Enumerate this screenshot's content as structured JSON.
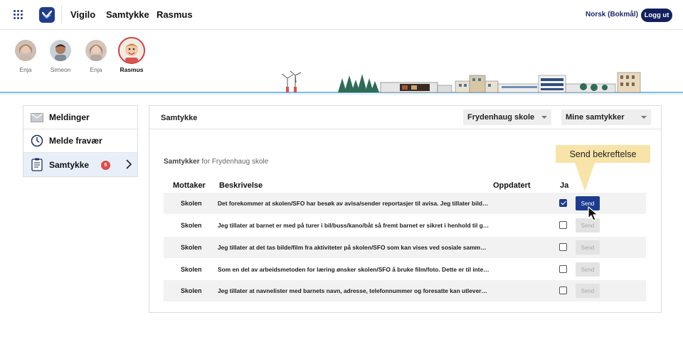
{
  "topbar": {
    "brand": "Vigilo",
    "nav": [
      "Samtykke",
      "Rasmus"
    ],
    "language": "Norsk (Bokmål)",
    "logout": "Logg ut"
  },
  "children": [
    {
      "name": "Enja"
    },
    {
      "name": "Simeon"
    },
    {
      "name": "Enja"
    },
    {
      "name": "Rasmus"
    }
  ],
  "sidebar": {
    "items": [
      {
        "label": "Meldinger",
        "icon": "envelope-icon"
      },
      {
        "label": "Melde fravær",
        "icon": "clock-icon"
      },
      {
        "label": "Samtykke",
        "icon": "clipboard-icon",
        "badge": "5",
        "active": true
      }
    ]
  },
  "panel": {
    "title": "Samtykke",
    "school_select": "Frydenhaug skole",
    "filter_select": "Mine samtykker",
    "subheading_bold": "Samtykker",
    "subheading_rest": " for Frydenhaug skole",
    "columns": [
      "Mottaker",
      "Beskrivelse",
      "Oppdatert",
      "Ja"
    ],
    "rows": [
      {
        "receiver": "Skolen",
        "description": "Det forekommer at skolen/SFO har besøk av avisa/sender reportasjer til avisa. Jeg tillater bilde…",
        "checked": true,
        "send": "Send"
      },
      {
        "receiver": "Skolen",
        "description": "Jeg tillater at barnet er med på turer i bil/buss/kano/båt så fremt barnet er sikret i henhold til gj…",
        "checked": false,
        "send": "Send"
      },
      {
        "receiver": "Skolen",
        "description": "Jeg tillater at det tas bilde/film fra aktiviteter på skolen/SFO som kan vises ved sosiale samme…",
        "checked": false,
        "send": "Send"
      },
      {
        "receiver": "Skolen",
        "description": "Som en del av arbeidsmetoden for læring ønsker skolen/SFO å bruke film/foto. Dette er til inter…",
        "checked": false,
        "send": "Send"
      },
      {
        "receiver": "Skolen",
        "description": "Jeg tillater at navnelister med barnets navn, adresse, telefonnummer og foresatte kan utlevere…",
        "checked": false,
        "send": "Send"
      }
    ]
  },
  "tooltip": "Send bekreftelse",
  "colors": {
    "navy": "#12205e",
    "primary": "#1d3c8d",
    "badge": "#e14a4a",
    "tooltip": "#f8e4a8",
    "sky_line": "#5aa9d6"
  }
}
